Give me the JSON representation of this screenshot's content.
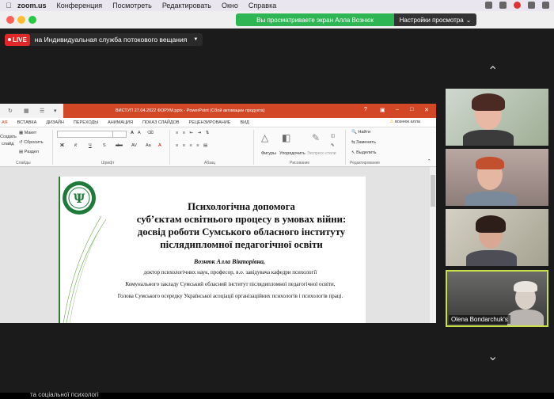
{
  "menubar": {
    "items": [
      "zoom.us",
      "Конференция",
      "Посмотреть",
      "Редактировать",
      "Окно",
      "Справка"
    ]
  },
  "zoom": {
    "viewing_text": "Вы просматриваете экран Алла Вознюк",
    "view_options": "Настройки просмотра",
    "live_badge": "LIVE",
    "live_name": "на Индивидуальная служба потокового вещания"
  },
  "powerpoint": {
    "title": "ВИСТУП 27.04.2022 ФОРУМ.pptx - PowerPoint (Сбой активации продукта)",
    "tabs": [
      "АЯ",
      "ВСТАВКА",
      "ДИЗАЙН",
      "ПЕРЕХОДЫ",
      "АНИМАЦИЯ",
      "ПОКАЗ СЛАЙДОВ",
      "РЕЦЕНЗИРОВАНИЕ",
      "ВИД"
    ],
    "user": "вознюк алла",
    "ribbon": {
      "maket": "Макет",
      "sbrosit": "Сбросить",
      "razdel": "Раздел",
      "sozdat": "Создать",
      "slaid": "слайд",
      "slides_group": "Слайды",
      "font_group": "Шрифт",
      "para_group": "Абзац",
      "drawing_group": "Рисование",
      "edit_group": "Редактирование",
      "figures": "Фигуры",
      "arrange": "Упорядочить",
      "express": "Экспресс-стили",
      "find": "Найти",
      "replace": "Заменить",
      "select": "Выделить"
    },
    "slide": {
      "title_lines": [
        "Психологічна допомога",
        "суб’єктам освітнього процесу в умовах війни:",
        "досвід роботи Сумського обласного інституту",
        "післядипломної педагогічної освіти"
      ],
      "author": "Вознюк Алла Вікторівна,",
      "lines": [
        "доктор психологічних наук, професор, в.о. завідувача кафедри психології",
        "Комунального закладу Сумський обласний інститут післядипломної педагогічної освіти,",
        "Голова Сумського осередку Української асоціації організаційних психологів і психологів праці."
      ]
    }
  },
  "participants": [
    {
      "name": ""
    },
    {
      "name": ""
    },
    {
      "name": ""
    },
    {
      "name": "Olena Bondarchuk's"
    }
  ],
  "bottom_text": "та соціальної психологі"
}
